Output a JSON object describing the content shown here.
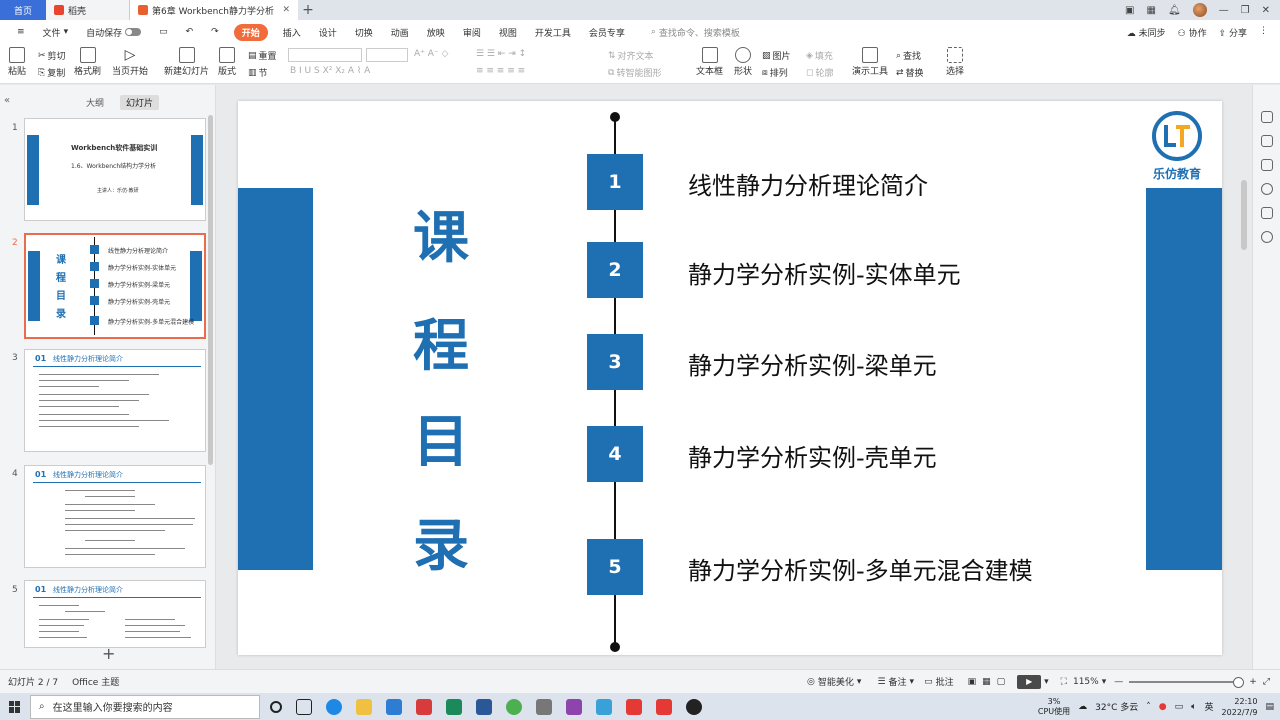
{
  "tabs": {
    "home": "首页",
    "doc1": "稻壳",
    "active": "第6章 Workbench静力学分析"
  },
  "menu": {
    "file": "文件",
    "autosave": "自动保存",
    "items": [
      "开始",
      "插入",
      "设计",
      "切换",
      "动画",
      "放映",
      "审阅",
      "视图",
      "开发工具",
      "会员专享"
    ],
    "search": "查找命令、搜索模板",
    "sync": "未同步",
    "collab": "协作",
    "share": "分享"
  },
  "ribbon": {
    "paste": "粘贴",
    "cut": "剪切",
    "copy": "复制",
    "format_painter": "格式刷",
    "from_current": "当页开始",
    "new_slide": "新建幻灯片",
    "layout": "版式",
    "reset": "重置",
    "section": "节",
    "text_box": "文本框",
    "shape": "形状",
    "picture": "图片",
    "fill": "填充",
    "arrange": "排列",
    "outline": "轮廓",
    "present_tools": "演示工具",
    "find": "查找",
    "replace": "替换",
    "select": "选择",
    "to_smartart": "转智能图形",
    "text_direction": "对齐文本"
  },
  "left_panel": {
    "tab_outline": "大纲",
    "tab_slides": "幻灯片",
    "slide_numbers": [
      "1",
      "2",
      "3",
      "4",
      "5"
    ],
    "thumb1": {
      "title": "Workbench软件基础实训",
      "subtitle": "1.6、Workbench结构力学分析",
      "speaker": "主讲人：乐仿·教研"
    },
    "thumb2": {
      "title_chars": [
        "课",
        "程",
        "目",
        "录"
      ],
      "items": [
        "线性静力分析理论简介",
        "静力学分析实例-实体单元",
        "静力学分析实例-梁单元",
        "静力学分析实例-壳单元",
        "静力学分析实例-多单元混合建模"
      ]
    },
    "thumb3": {
      "num": "01",
      "title": "线性静力分析理论简介"
    },
    "thumb4": {
      "num": "01",
      "title": "线性静力分析理论简介"
    },
    "thumb5": {
      "num": "01",
      "title": "线性静力分析理论简介"
    }
  },
  "slide": {
    "title_chars": [
      "课",
      "程",
      "目",
      "录"
    ],
    "items": [
      {
        "num": "1",
        "text": "线性静力分析理论简介"
      },
      {
        "num": "2",
        "text": "静力学分析实例-实体单元"
      },
      {
        "num": "3",
        "text": "静力学分析实例-梁单元"
      },
      {
        "num": "4",
        "text": "静力学分析实例-壳单元"
      },
      {
        "num": "5",
        "text": "静力学分析实例-多单元混合建模"
      }
    ],
    "logo_text": "乐仿教育",
    "accent_color": "#1f6fb3"
  },
  "status": {
    "slide_pos": "幻灯片 2 / 7",
    "theme": "Office 主题",
    "smart_beautify": "智能美化",
    "notes": "备注",
    "comments": "批注",
    "zoom": "115%"
  },
  "taskbar": {
    "search_placeholder": "在这里输入你要搜索的内容",
    "cpu_percent": "3%",
    "cpu_label": "CPU使用",
    "temp": "32°C 多云",
    "time": "22:10",
    "date": "2022/7/9",
    "lang": "英"
  }
}
